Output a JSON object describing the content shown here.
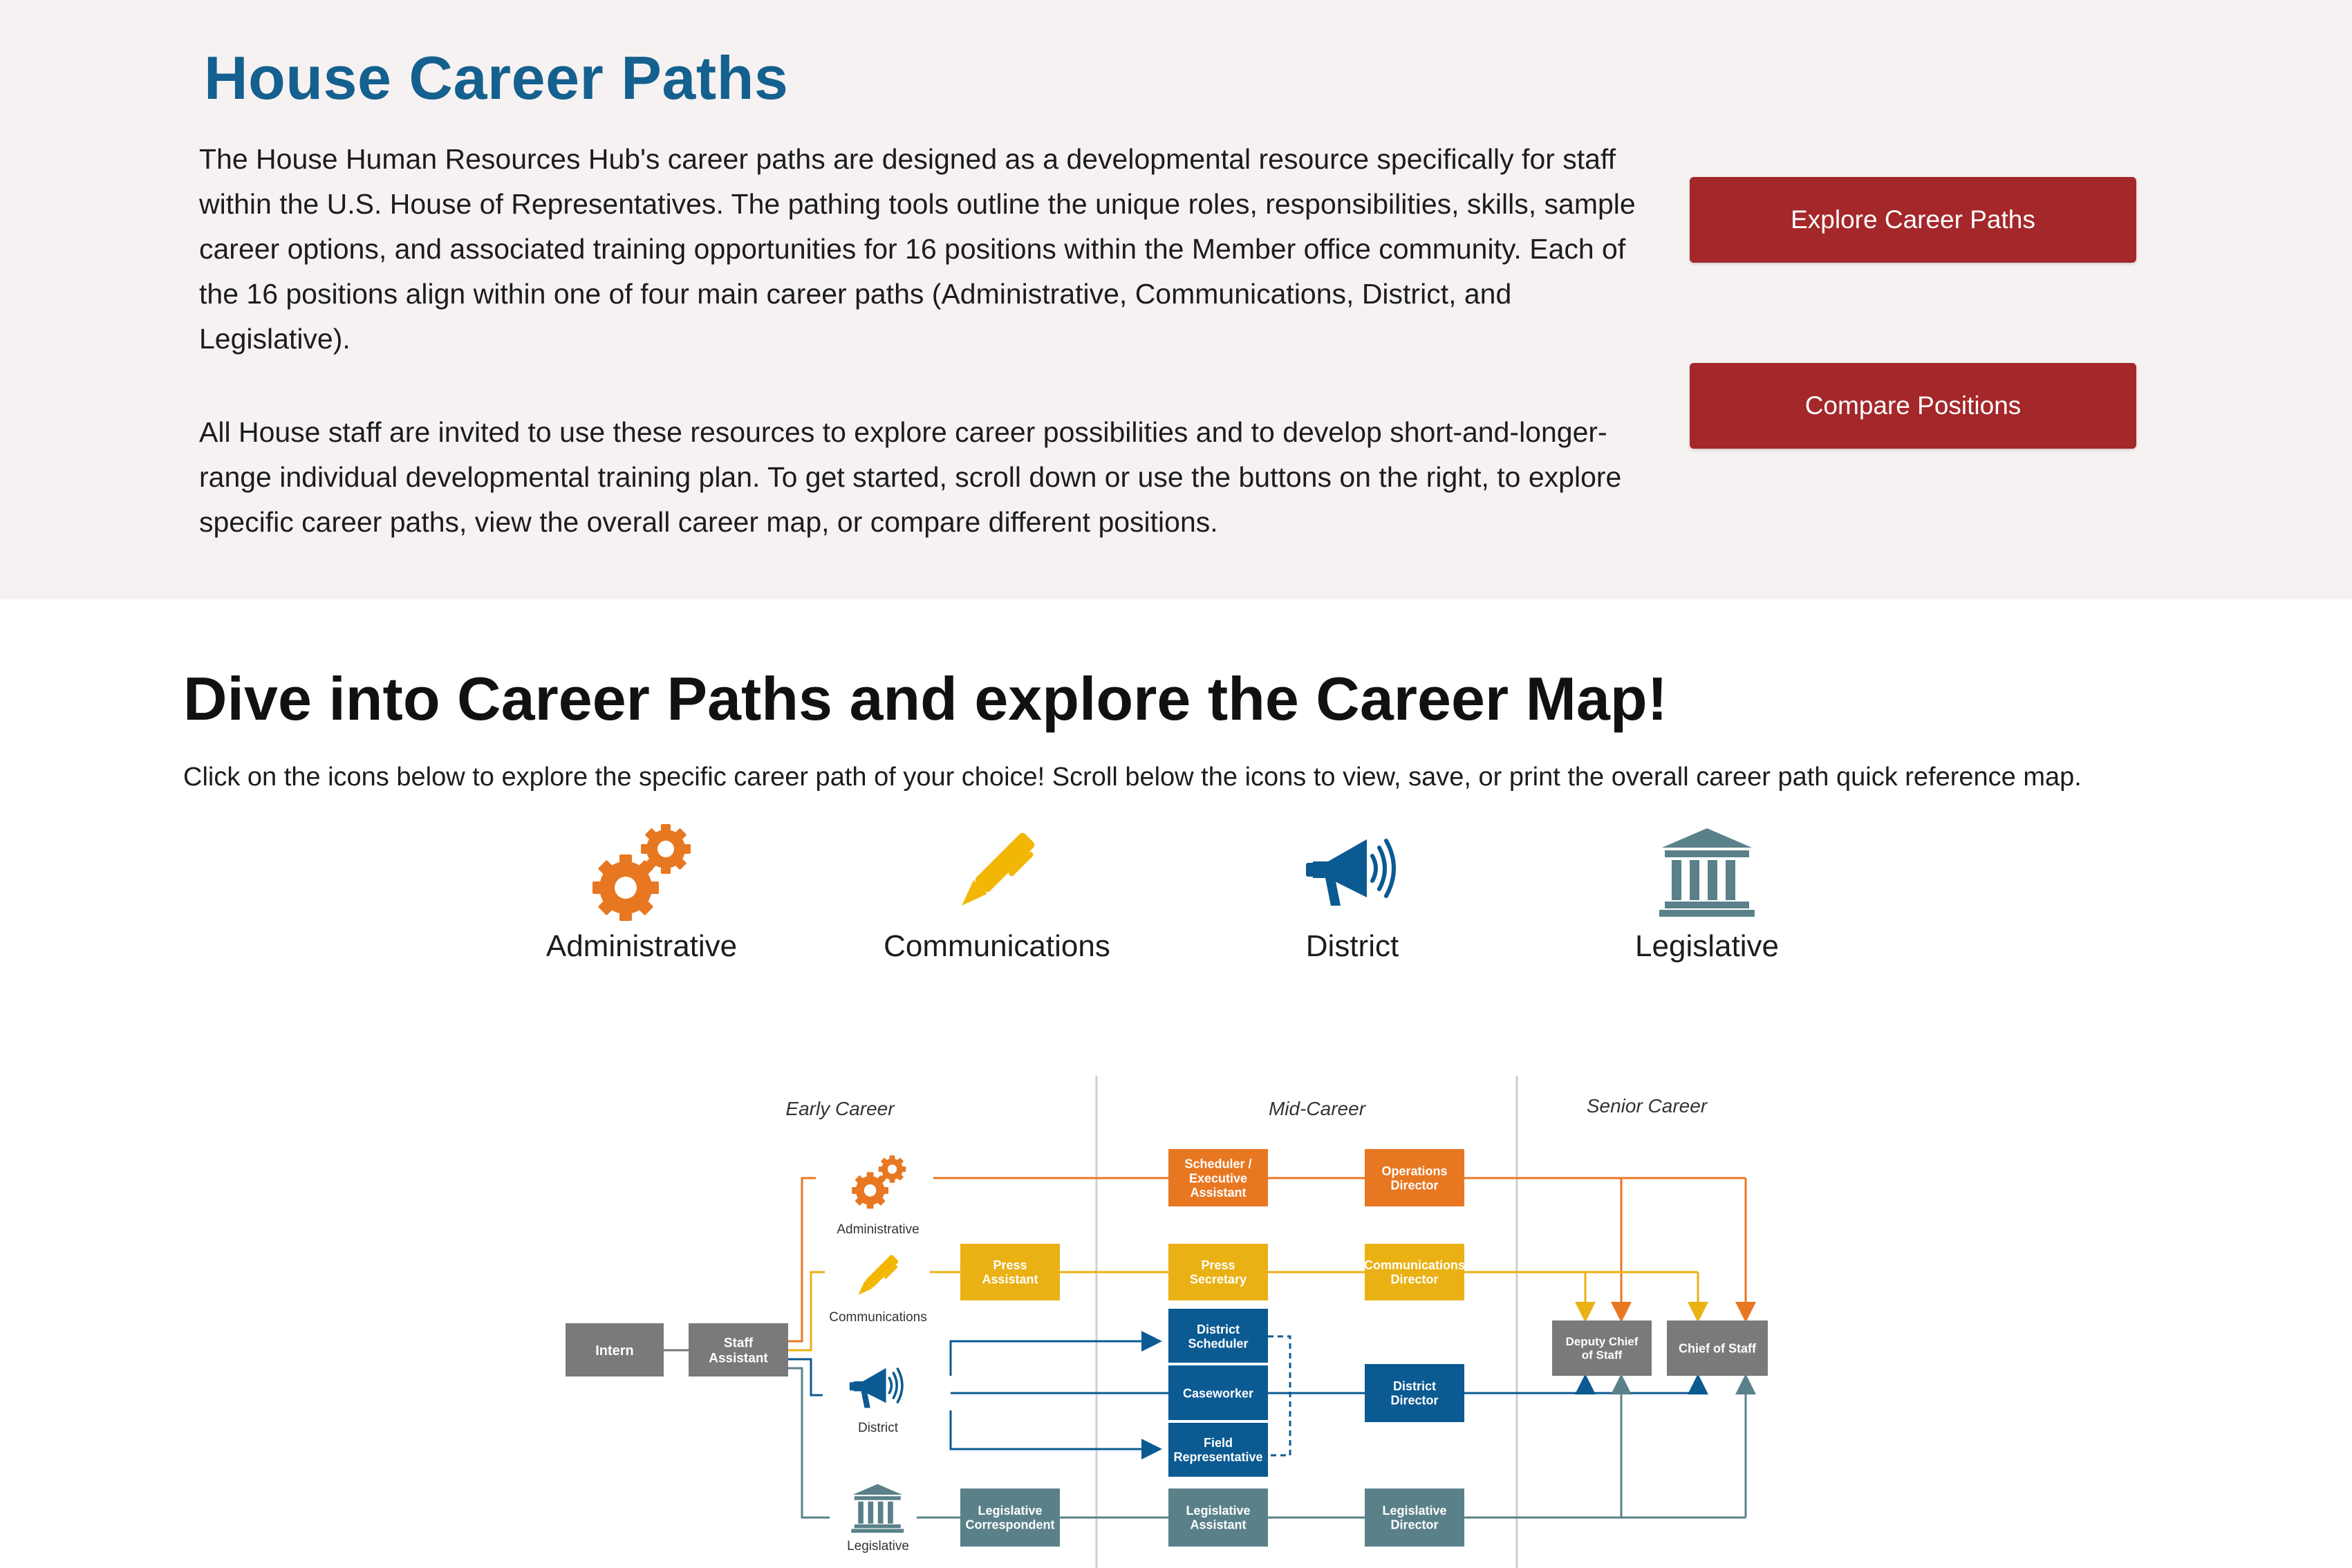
{
  "hero": {
    "title": "House Career Paths",
    "paragraph1": "The House Human Resources Hub's career paths are designed as a developmental resource specifically for staff within the U.S. House of Representatives. The pathing tools outline the unique roles, responsibilities, skills, sample career options, and associated training opportunities for 16 positions within the Member office community. Each of the 16 positions align within one of four main career paths (Administrative, Communications, District, and Legislative).",
    "paragraph2": "All House staff are invited to use these resources to explore career possibilities and to develop short-and-longer-range individual developmental training plan. To get started, scroll down or use the buttons on the right, to explore specific career paths, view the overall career map, or compare different positions.",
    "buttons": {
      "explore": "Explore Career Paths",
      "compare": "Compare Positions"
    }
  },
  "section": {
    "title": "Dive into Career Paths and explore the Career Map!",
    "text": "Click on the icons below to explore the specific career path of your choice! Scroll below the icons to view, save, or print the overall career path quick reference map."
  },
  "paths": [
    {
      "label": "Administrative",
      "icon": "gears-icon",
      "color": "#e87722"
    },
    {
      "label": "Communications",
      "icon": "pen-icon",
      "color": "#f2b705"
    },
    {
      "label": "District",
      "icon": "megaphone-icon",
      "color": "#0b5a92"
    },
    {
      "label": "Legislative",
      "icon": "capitol-building-icon",
      "color": "#5a8189"
    }
  ],
  "map": {
    "stages": {
      "early": "Early Career",
      "mid": "Mid-Career",
      "senior": "Senior Career"
    },
    "path_labels": {
      "administrative": "Administrative",
      "communications": "Communications",
      "district": "District",
      "legislative": "Legislative"
    },
    "colors": {
      "gray": "#7a7a7a",
      "orange": "#e87722",
      "yellow": "#e9b114",
      "blue": "#0b5a92",
      "teal": "#5a8189"
    },
    "boxes": {
      "intern": [
        "Intern"
      ],
      "staff_assistant": [
        "Staff",
        "Assistant"
      ],
      "scheduler": [
        "Scheduler /",
        "Executive",
        "Assistant"
      ],
      "operations_director": [
        "Operations",
        "Director"
      ],
      "press_assistant": [
        "Press",
        "Assistant"
      ],
      "press_secretary": [
        "Press",
        "Secretary"
      ],
      "communications_director": [
        "Communications",
        "Director"
      ],
      "district_scheduler": [
        "District",
        "Scheduler"
      ],
      "caseworker": [
        "Caseworker"
      ],
      "field_rep": [
        "Field",
        "Representative"
      ],
      "district_director": [
        "District",
        "Director"
      ],
      "leg_correspondent": [
        "Legislative",
        "Correspondent"
      ],
      "leg_assistant": [
        "Legislative",
        "Assistant"
      ],
      "leg_director": [
        "Legislative",
        "Director"
      ],
      "deputy_cos": [
        "Deputy Chief",
        "of Staff"
      ],
      "cos": [
        "Chief of Staff"
      ]
    }
  }
}
